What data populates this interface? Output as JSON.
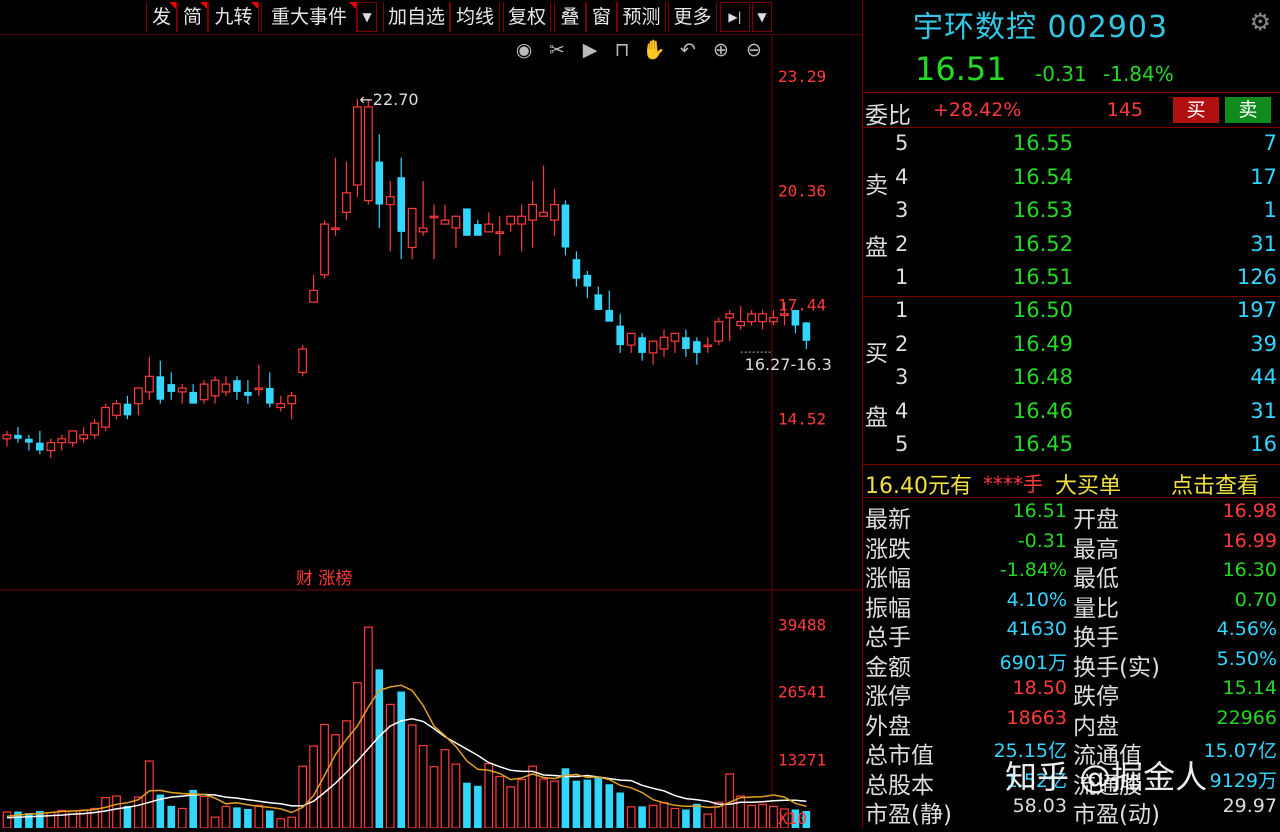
{
  "toolbar": {
    "items": [
      "发",
      "简",
      "九转",
      "重大事件",
      "加自选",
      "均线",
      "复权",
      "叠",
      "窗",
      "预测",
      "更多"
    ]
  },
  "colors": {
    "up": "#ff3b3b",
    "down": "#33d6ff",
    "bg": "#000000",
    "grid": "#7a0000",
    "ma5": "#ffffff",
    "ma10": "#e0a020"
  },
  "chart_data": {
    "type": "candlestick",
    "price_axis": [
      "23.29",
      "20.36",
      "17.44",
      "14.52"
    ],
    "ylim": [
      13.2,
      23.6
    ],
    "max_label": "22.70",
    "range_label": "16.27-16.3",
    "candles": [
      [
        14.0,
        14.2,
        13.8,
        14.1
      ],
      [
        14.1,
        14.3,
        13.9,
        14.0
      ],
      [
        14.0,
        14.1,
        13.7,
        13.9
      ],
      [
        13.9,
        14.2,
        13.6,
        13.7
      ],
      [
        13.7,
        14.0,
        13.5,
        13.9
      ],
      [
        13.9,
        14.1,
        13.7,
        14.0
      ],
      [
        13.9,
        14.2,
        13.8,
        14.2
      ],
      [
        14.0,
        14.3,
        13.9,
        14.1
      ],
      [
        14.1,
        14.5,
        14.0,
        14.4
      ],
      [
        14.3,
        14.9,
        14.2,
        14.8
      ],
      [
        14.6,
        15.0,
        14.5,
        14.9
      ],
      [
        14.9,
        15.1,
        14.5,
        14.6
      ],
      [
        14.9,
        15.3,
        14.6,
        15.3
      ],
      [
        15.2,
        16.1,
        15.0,
        15.6
      ],
      [
        15.6,
        16.0,
        14.9,
        15.0
      ],
      [
        15.4,
        15.7,
        15.0,
        15.2
      ],
      [
        15.2,
        15.4,
        14.9,
        15.3
      ],
      [
        15.2,
        15.4,
        14.9,
        14.9
      ],
      [
        15.0,
        15.5,
        14.9,
        15.4
      ],
      [
        15.1,
        15.6,
        14.9,
        15.5
      ],
      [
        15.2,
        15.6,
        15.1,
        15.4
      ],
      [
        15.5,
        15.6,
        15.0,
        15.2
      ],
      [
        15.2,
        15.5,
        14.9,
        15.1
      ],
      [
        15.3,
        15.9,
        15.1,
        15.3
      ],
      [
        15.3,
        15.7,
        14.8,
        14.9
      ],
      [
        14.8,
        15.1,
        14.7,
        14.9
      ],
      [
        14.9,
        15.2,
        14.5,
        15.1
      ],
      [
        15.7,
        16.4,
        15.6,
        16.3
      ],
      [
        17.5,
        18.2,
        17.5,
        17.8
      ],
      [
        18.2,
        19.6,
        18.1,
        19.5
      ],
      [
        19.4,
        21.2,
        19.2,
        19.4
      ],
      [
        19.8,
        21.1,
        19.6,
        20.3
      ],
      [
        20.5,
        22.7,
        20.2,
        22.5
      ],
      [
        20.1,
        22.7,
        20.0,
        22.5
      ],
      [
        21.1,
        21.8,
        19.4,
        20.0
      ],
      [
        20.0,
        20.6,
        18.8,
        20.2
      ],
      [
        20.7,
        21.2,
        18.6,
        19.3
      ],
      [
        18.9,
        19.9,
        18.6,
        19.9
      ],
      [
        19.3,
        20.6,
        19.2,
        19.4
      ],
      [
        19.7,
        20.0,
        18.6,
        19.7
      ],
      [
        19.5,
        20.0,
        19.5,
        19.6
      ],
      [
        19.4,
        19.6,
        18.9,
        19.7
      ],
      [
        19.9,
        19.9,
        19.2,
        19.2
      ],
      [
        19.5,
        19.6,
        19.4,
        19.2
      ],
      [
        19.3,
        19.8,
        19.3,
        19.5
      ],
      [
        19.3,
        19.7,
        18.7,
        19.3
      ],
      [
        19.5,
        19.5,
        19.3,
        19.7
      ],
      [
        19.5,
        20.0,
        18.8,
        19.7
      ],
      [
        19.6,
        20.6,
        18.9,
        20.0
      ],
      [
        19.7,
        21.0,
        19.7,
        19.8
      ],
      [
        19.6,
        20.4,
        19.2,
        20.0
      ],
      [
        20.0,
        20.1,
        18.7,
        18.9
      ],
      [
        18.6,
        18.8,
        17.9,
        18.1
      ],
      [
        18.2,
        18.3,
        17.6,
        17.9
      ],
      [
        17.7,
        17.9,
        17.4,
        17.3
      ],
      [
        17.3,
        17.8,
        17.1,
        17.0
      ],
      [
        16.9,
        17.2,
        16.2,
        16.4
      ],
      [
        16.4,
        16.7,
        16.2,
        16.7
      ],
      [
        16.6,
        16.7,
        16.0,
        16.2
      ],
      [
        16.2,
        16.5,
        15.9,
        16.5
      ],
      [
        16.3,
        16.8,
        16.1,
        16.6
      ],
      [
        16.5,
        16.7,
        16.2,
        16.7
      ],
      [
        16.6,
        16.8,
        16.1,
        16.3
      ],
      [
        16.5,
        16.6,
        15.9,
        16.2
      ],
      [
        16.4,
        16.6,
        16.2,
        16.4
      ],
      [
        16.5,
        17.1,
        16.4,
        17.0
      ],
      [
        17.1,
        17.3,
        16.5,
        17.2
      ],
      [
        16.9,
        17.4,
        16.8,
        17.0
      ],
      [
        17.0,
        17.3,
        16.9,
        17.2
      ],
      [
        17.0,
        17.3,
        16.8,
        17.2
      ],
      [
        17.0,
        17.3,
        16.9,
        17.1
      ],
      [
        17.2,
        17.5,
        16.9,
        17.2
      ],
      [
        17.3,
        17.3,
        16.7,
        16.9
      ],
      [
        16.98,
        16.99,
        16.3,
        16.51
      ]
    ],
    "volume_axis": [
      "39488",
      "26541",
      "13271",
      "X10"
    ],
    "vol_max": 40000,
    "volumes": [
      3100,
      3200,
      2900,
      3300,
      3000,
      3400,
      3300,
      3500,
      3800,
      5900,
      6200,
      4300,
      6000,
      13000,
      6500,
      4300,
      3800,
      7400,
      6100,
      2100,
      4200,
      4000,
      3700,
      4400,
      3400,
      1800,
      2100,
      12000,
      15900,
      20100,
      18100,
      20800,
      28200,
      39000,
      30800,
      24000,
      26500,
      20000,
      16000,
      11900,
      15200,
      12400,
      8800,
      8200,
      12500,
      10000,
      8000,
      9400,
      12000,
      9500,
      9100,
      11600,
      9200,
      9400,
      9900,
      8500,
      6900,
      4100,
      4200,
      4400,
      4900,
      3800,
      3600,
      4700,
      2700,
      5000,
      10500,
      6200,
      4400,
      4600,
      4200,
      3700,
      3600,
      3300
    ],
    "ma5": [
      2300,
      2500,
      2700,
      2800,
      3000,
      3200,
      3300,
      3400,
      3600,
      4000,
      4600,
      4900,
      5500,
      7200,
      7300,
      6900,
      6700,
      6600,
      6500,
      5800,
      4700,
      4900,
      4500,
      4200,
      4000,
      3700,
      3000,
      4000,
      6300,
      10200,
      14300,
      17200,
      19800,
      23500,
      26700,
      27400,
      27700,
      26700,
      23800,
      19800,
      17900,
      15800,
      13000,
      11400,
      11200,
      10600,
      9400,
      9700,
      10500,
      9800,
      9600,
      10200,
      10400,
      9800,
      9900,
      9400,
      8300,
      7800,
      6900,
      5500,
      4900,
      4400,
      4200,
      4300,
      4000,
      4100,
      5000,
      5900,
      6000,
      6100,
      6400,
      6000,
      4800,
      4200
    ],
    "ma10": [
      2000,
      2100,
      2200,
      2300,
      2400,
      2500,
      2700,
      2800,
      3000,
      3300,
      3700,
      4000,
      4400,
      5000,
      5600,
      6000,
      6200,
      6400,
      6500,
      6400,
      6000,
      5800,
      5500,
      5200,
      4900,
      4700,
      4300,
      4300,
      5200,
      6900,
      8700,
      10800,
      13000,
      15400,
      17800,
      19800,
      20800,
      21200,
      20700,
      19300,
      17700,
      16500,
      15300,
      14100,
      12700,
      11900,
      11200,
      11000,
      11000,
      10300,
      10200,
      10000,
      10000,
      10200,
      9900,
      9600,
      9300,
      9200,
      8300,
      7700,
      7200,
      6300,
      5700,
      5500,
      5200,
      4600,
      4600,
      5000,
      5000,
      5100,
      5300,
      5400,
      5400,
      5200
    ],
    "marker_text": "财 涨榜"
  },
  "panel": {
    "title": "宇环数控 002903",
    "price": "16.51",
    "change": "-0.31",
    "change_pct": "-1.84%",
    "weibi_label": "委比",
    "weibi_value": "+28.42%",
    "weibi_diff": "145",
    "buy_btn": "买",
    "sell_btn": "卖",
    "sell_label_1": "卖",
    "sell_label_2": "盘",
    "buy_label_1": "买",
    "buy_label_2": "盘",
    "sell_levels": [
      {
        "n": "5",
        "p": "16.55",
        "v": "7"
      },
      {
        "n": "4",
        "p": "16.54",
        "v": "17"
      },
      {
        "n": "3",
        "p": "16.53",
        "v": "1"
      },
      {
        "n": "2",
        "p": "16.52",
        "v": "31"
      },
      {
        "n": "1",
        "p": "16.51",
        "v": "126"
      }
    ],
    "buy_levels": [
      {
        "n": "1",
        "p": "16.50",
        "v": "197"
      },
      {
        "n": "2",
        "p": "16.49",
        "v": "39"
      },
      {
        "n": "3",
        "p": "16.48",
        "v": "44"
      },
      {
        "n": "4",
        "p": "16.46",
        "v": "31"
      },
      {
        "n": "5",
        "p": "16.45",
        "v": "16"
      }
    ],
    "bigorder": {
      "left": "16.40元有",
      "stars": "****手",
      "mid": "大买单",
      "right": "点击查看"
    },
    "stats": [
      {
        "l1": "最新",
        "v1": "16.51",
        "c1": "green",
        "l2": "开盘",
        "v2": "16.98",
        "c2": "red"
      },
      {
        "l1": "涨跌",
        "v1": "-0.31",
        "c1": "green",
        "l2": "最高",
        "v2": "16.99",
        "c2": "red"
      },
      {
        "l1": "涨幅",
        "v1": "-1.84%",
        "c1": "green",
        "l2": "最低",
        "v2": "16.30",
        "c2": "green"
      },
      {
        "l1": "振幅",
        "v1": "4.10%",
        "c1": "cyan",
        "l2": "量比",
        "v2": "0.70",
        "c2": "green"
      },
      {
        "l1": "总手",
        "v1": "41630",
        "c1": "cyan",
        "l2": "换手",
        "v2": "4.56%",
        "c2": "cyan"
      },
      {
        "l1": "金额",
        "v1": "6901万",
        "c1": "cyan",
        "l2": "换手(实)",
        "v2": "5.50%",
        "c2": "cyan"
      },
      {
        "l1": "涨停",
        "v1": "18.50",
        "c1": "red",
        "l2": "跌停",
        "v2": "15.14",
        "c2": "green"
      },
      {
        "l1": "外盘",
        "v1": "18663",
        "c1": "red",
        "l2": "内盘",
        "v2": "22966",
        "c2": "green"
      },
      {
        "l1": "总市值",
        "v1": "25.15亿",
        "c1": "cyan",
        "l2": "流通值",
        "v2": "15.07亿",
        "c2": "cyan"
      },
      {
        "l1": "总股本",
        "v1": "1.52亿",
        "c1": "cyan",
        "l2": "流通股",
        "v2": "9129万",
        "c2": "cyan"
      },
      {
        "l1": "市盈(静)",
        "v1": "58.03",
        "c1": "white",
        "l2": "市盈(动)",
        "v2": "29.97",
        "c2": "white"
      }
    ]
  },
  "watermark": "知乎 @掘金人"
}
